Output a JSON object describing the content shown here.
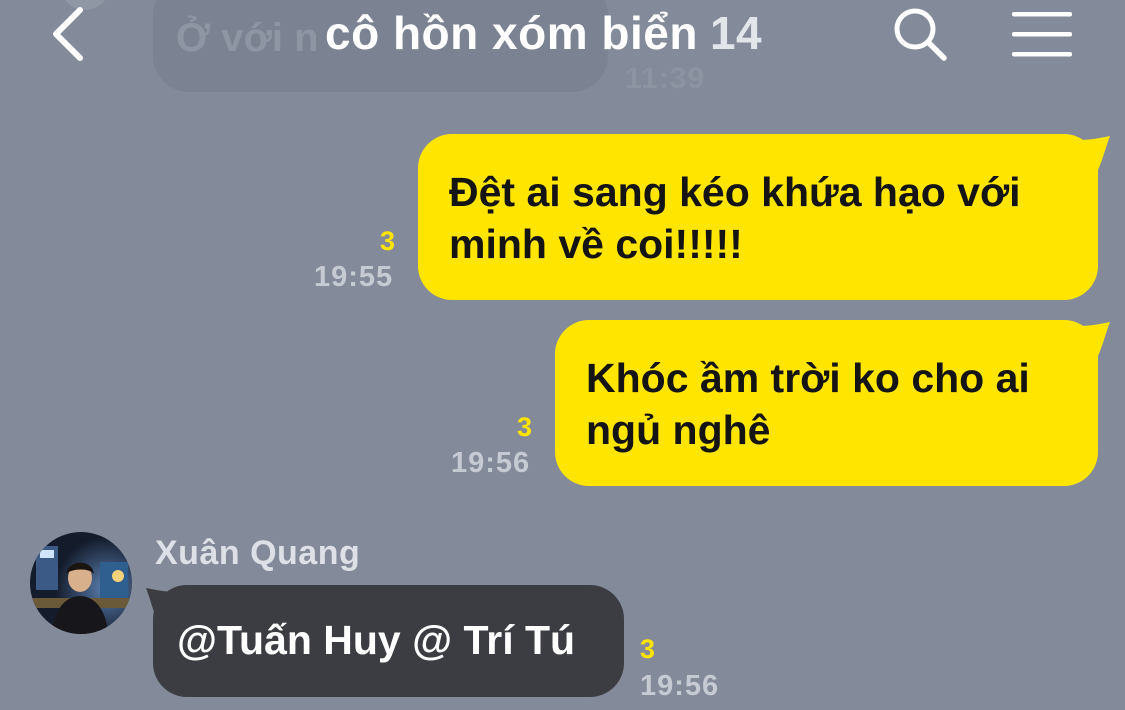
{
  "header": {
    "title": "cô hồn xóm biển",
    "member_count": "14",
    "back_icon": "chevron-left-icon",
    "search_icon": "search-icon",
    "menu_icon": "hamburger-menu-icon"
  },
  "previous_message": {
    "text": "Ở với n",
    "time": "11:39"
  },
  "messages": [
    {
      "direction": "outgoing",
      "text": "Đệt ai sang kéo khứa hạo với\nminh về coi!!!!!",
      "read_count": "3",
      "time": "19:55"
    },
    {
      "direction": "outgoing",
      "text": "Khóc ầm trời ko cho ai\nngủ nghê",
      "read_count": "3",
      "time": "19:56"
    },
    {
      "direction": "incoming",
      "sender": "Xuân Quang",
      "text": "@Tuấn Huy @ Trí Tú",
      "read_count": "3",
      "time": "19:56"
    }
  ],
  "colors": {
    "background": "#838a99",
    "outgoing_bubble": "#ffe500",
    "incoming_bubble": "#3b3d42",
    "read_count": "#ffe500",
    "time_text": "#c5cad3"
  }
}
